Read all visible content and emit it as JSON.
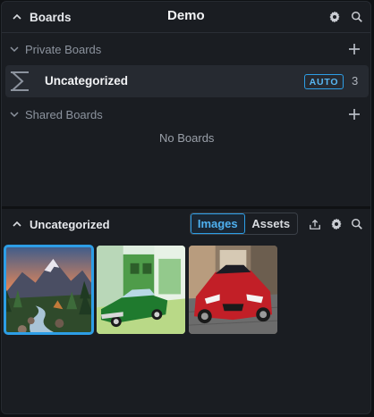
{
  "boards_panel": {
    "title": "Boards",
    "active_board": "Demo",
    "private_section": "Private Boards",
    "shared_section": "Shared Boards",
    "empty_text": "No Boards",
    "boards": [
      {
        "name": "Uncategorized",
        "badge": "AUTO",
        "count": "3"
      }
    ]
  },
  "gallery": {
    "title": "Uncategorized",
    "tabs": [
      {
        "label": "Images",
        "active": true
      },
      {
        "label": "Assets",
        "active": false
      }
    ],
    "images": [
      {
        "name": "mountain-river-landscape",
        "selected": true
      },
      {
        "name": "green-classic-car",
        "selected": false
      },
      {
        "name": "red-sports-car",
        "selected": false
      }
    ]
  },
  "colors": {
    "accent": "#2d9ee6",
    "panel": "#1a1d22",
    "row_highlight": "#262a31"
  },
  "icons": [
    "chevron-up-icon",
    "gear-icon",
    "search-icon",
    "chevron-down-icon",
    "plus-icon",
    "uncategorized-board-icon",
    "upload-icon"
  ]
}
